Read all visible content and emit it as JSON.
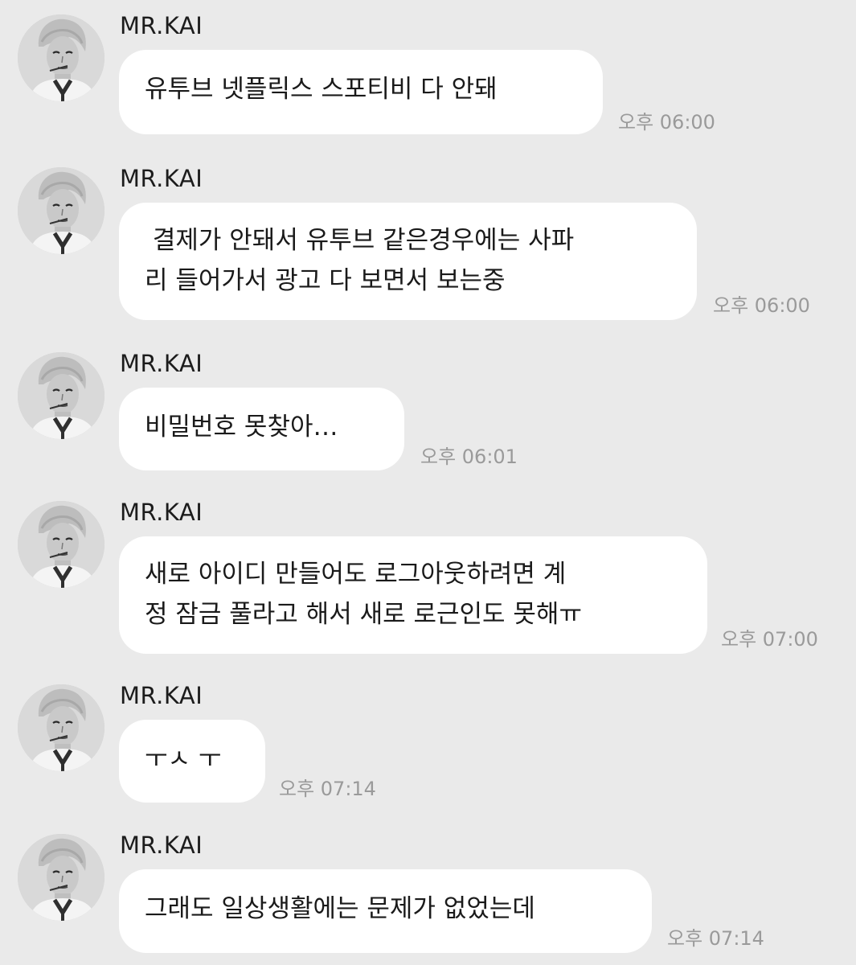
{
  "messages": [
    {
      "sender": "MR.KAI",
      "text": "유투브 넷플릭스 스포티비 다 안돼",
      "time": "오후 06:00"
    },
    {
      "sender": "MR.KAI",
      "text": " 결제가 안돼서 유투브 같은경우에는 사파\n리 들어가서 광고 다 보면서 보는중",
      "time": "오후 06:00"
    },
    {
      "sender": "MR.KAI",
      "text": "비밀번호 못찾아…",
      "time": "오후 06:01"
    },
    {
      "sender": "MR.KAI",
      "text": "새로 아이디 만들어도 로그아웃하려면 계\n정 잠금 풀라고 해서 새로 로근인도 못해ㅠ",
      "time": "오후 07:00"
    },
    {
      "sender": "MR.KAI",
      "text": "ㅜㅅ ㅜ",
      "time": "오후 07:14"
    },
    {
      "sender": "MR.KAI",
      "text": "그래도 일상생활에는 문제가 없었는데",
      "time": "오후 07:14"
    }
  ]
}
